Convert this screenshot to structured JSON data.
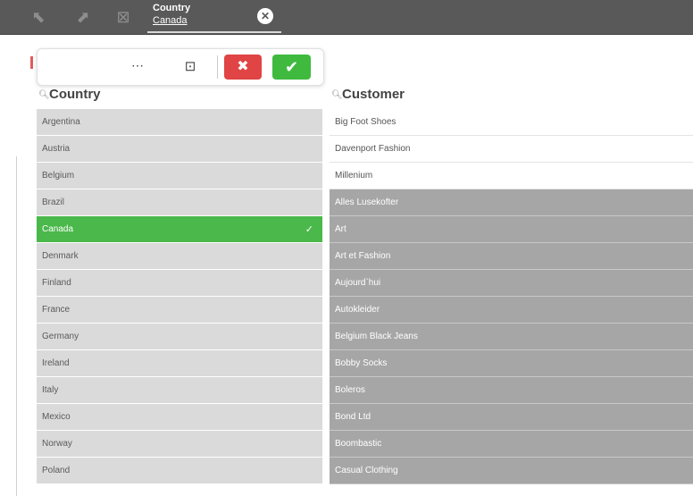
{
  "selection_bar": {
    "icons": [
      "step-back-icon",
      "step-forward-icon",
      "clear-all-icon"
    ],
    "chip": {
      "field": "Country",
      "value": "Canada"
    }
  },
  "listbox_toolbar": {
    "more": "⋯"
  },
  "country": {
    "title": "Country",
    "items": [
      "Argentina",
      "Austria",
      "Belgium",
      "Brazil",
      "Canada",
      "Denmark",
      "Finland",
      "France",
      "Germany",
      "Ireland",
      "Italy",
      "Mexico",
      "Norway",
      "Poland"
    ],
    "selected": "Canada"
  },
  "customer": {
    "title": "Customer",
    "possible": [
      "Big Foot Shoes",
      "Davenport Fashion",
      "Millenium"
    ],
    "excluded": [
      "Alles Lusekofter",
      "Art",
      "Art et Fashion",
      "Aujourd`hui",
      "Autokleider",
      "Belgium Black Jeans",
      "Bobby Socks",
      "Boleros",
      "Bond Ltd",
      "Boombastic",
      "Casual Clothing"
    ]
  },
  "colors": {
    "selected": "#4ab84a",
    "alternative": "#dadada",
    "excluded": "#a6a6a6",
    "cancel": "#e04444",
    "confirm": "#3fba3f"
  }
}
